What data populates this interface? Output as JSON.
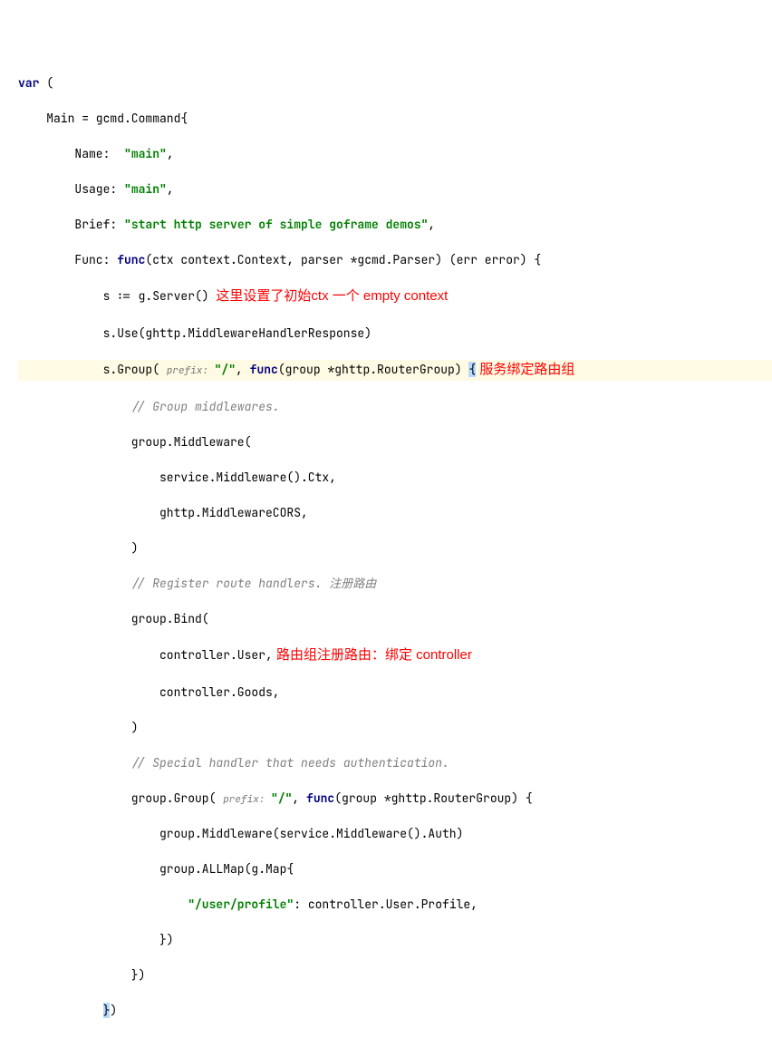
{
  "code": {
    "kw_var": "var",
    "l1_a": " (",
    "l2_a": "    Main = gcmd.Command{",
    "l3_a": "        Name:  ",
    "l3_str": "\"main\"",
    "l3_b": ",",
    "l4_a": "        Usage: ",
    "l4_str": "\"main\"",
    "l4_b": ",",
    "l5_a": "        Brief: ",
    "l5_str": "\"start http server of simple goframe demos\"",
    "l5_b": ",",
    "l6_a": "        Func: ",
    "kw_func": "func",
    "l6_b": "(ctx context.Context, parser *gcmd.Parser) (err error) {",
    "l7_a": "            s := g.Server() ",
    "ann1": "这里设置了初始ctx 一个 empty context",
    "l8_a": "            s.Use(ghttp.MiddlewareHandlerResponse)",
    "l9_a": "            s.Group( ",
    "hint_prefix": "prefix: ",
    "l9_str": "\"/\"",
    "l9_b": ", ",
    "l9_c": "(group *ghttp.RouterGroup) ",
    "ann2": "  服务绑定路由组",
    "l10_cmt": "// Group middlewares.",
    "l11_a": "                group.Middleware(",
    "l12_a": "                    service.Middleware().Ctx,",
    "l13_a": "                    ghttp.MiddlewareCORS,",
    "l14_a": "                )",
    "l15_cmt": "// Register route handlers. 注册路由",
    "l16_a": "                group.Bind(",
    "l17_a": "                    controller.User,",
    "ann3": "     路由组注册路由：绑定 controller",
    "l18_a": "                    controller.Goods,",
    "l19_a": "                )",
    "l20_cmt": "// Special handler that needs authentication.",
    "l21_a": "                group.Group( ",
    "l21_str": "\"/\"",
    "l21_b": ", ",
    "l21_c": "(group *ghttp.RouterGroup) {",
    "l22_a": "                    group.Middleware(service.Middleware().Auth)",
    "l23_a": "                    group.ALLMap(g.Map{",
    "l24_a": "                        ",
    "l24_str": "\"/user/profile\"",
    "l24_b": ": controller.User.Profile,",
    "l25_a": "                    })",
    "l26_a": "                })",
    "l27_a": "            ",
    "l27_b": ")"
  }
}
